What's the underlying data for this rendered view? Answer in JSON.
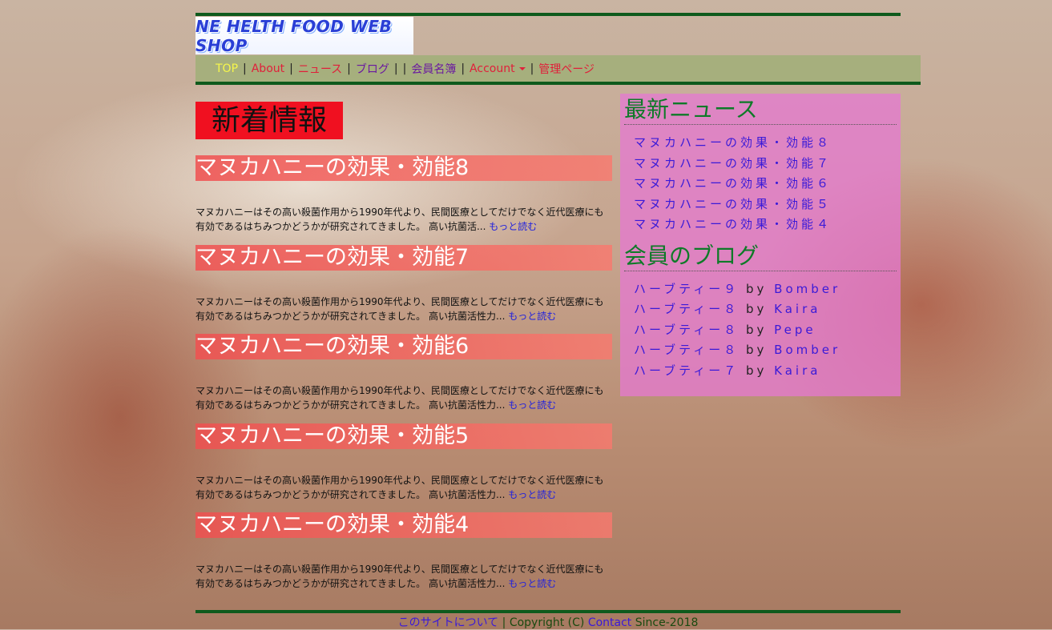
{
  "logo": {
    "text": "NE HELTH FOOD WEB SHOP"
  },
  "nav": {
    "top": "TOP",
    "about": "About",
    "news": "ニュース",
    "blog": "ブログ",
    "members": "会員名簿",
    "account": "Account",
    "admin": "管理ページ",
    "sep": "|"
  },
  "main": {
    "section_title": "新着情報",
    "posts": [
      {
        "title": "マヌカハニーの効果・効能8",
        "body": "マヌカハニーはその高い殺菌作用から1990年代より、民間医療としてだけでなく近代医療にも有効であるはちみつかどうかが研究されてきました。 高い抗菌活...",
        "more": "もっと読む"
      },
      {
        "title": "マヌカハニーの効果・効能7",
        "body": "マヌカハニーはその高い殺菌作用から1990年代より、民間医療としてだけでなく近代医療にも有効であるはちみつかどうかが研究されてきました。 高い抗菌活性力...",
        "more": "もっと読む"
      },
      {
        "title": "マヌカハニーの効果・効能6",
        "body": "マヌカハニーはその高い殺菌作用から1990年代より、民間医療としてだけでなく近代医療にも有効であるはちみつかどうかが研究されてきました。 高い抗菌活性力...",
        "more": "もっと読む"
      },
      {
        "title": "マヌカハニーの効果・効能5",
        "body": "マヌカハニーはその高い殺菌作用から1990年代より、民間医療としてだけでなく近代医療にも有効であるはちみつかどうかが研究されてきました。 高い抗菌活性力...",
        "more": "もっと読む"
      },
      {
        "title": "マヌカハニーの効果・効能4",
        "body": "マヌカハニーはその高い殺菌作用から1990年代より、民間医療としてだけでなく近代医療にも有効であるはちみつかどうかが研究されてきました。 高い抗菌活性力...",
        "more": "もっと読む"
      }
    ]
  },
  "sidebar": {
    "news_title": "最新ニュース",
    "news": [
      "マヌカハニーの効果・効能８",
      "マヌカハニーの効果・効能７",
      "マヌカハニーの効果・効能６",
      "マヌカハニーの効果・効能５",
      "マヌカハニーの効果・効能４"
    ],
    "blog_title": "会員のブログ",
    "by": "by",
    "blogs": [
      {
        "title": "ハーブティー９",
        "author": "Bomber"
      },
      {
        "title": "ハーブティー８",
        "author": "Kaira"
      },
      {
        "title": "ハーブティー８",
        "author": "Pepe"
      },
      {
        "title": "ハーブティー８",
        "author": "Bomber"
      },
      {
        "title": "ハーブティー７",
        "author": "Kaira"
      }
    ]
  },
  "footer": {
    "about": "このサイトについて",
    "sep": "|",
    "copyright": "Copyright (C)",
    "contact": "Contact",
    "since": "Since-2018"
  }
}
